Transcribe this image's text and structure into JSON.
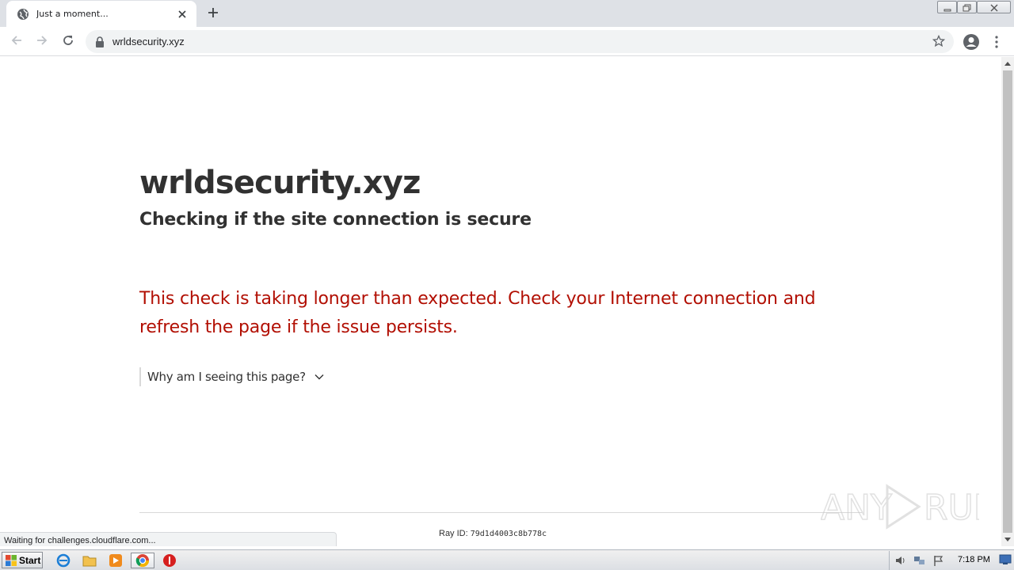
{
  "browser": {
    "tab": {
      "title": "Just a moment...",
      "favicon": "globe-icon",
      "close_icon": "close-icon"
    },
    "new_tab_icon": "plus-icon",
    "window_controls": [
      "minimize-icon",
      "restore-icon",
      "close-icon"
    ],
    "toolbar": {
      "back_icon": "back-arrow-icon",
      "forward_icon": "forward-arrow-icon",
      "reload_icon": "reload-icon",
      "url": "wrldsecurity.xyz",
      "lock_icon": "lock-icon",
      "bookmark_icon": "star-icon",
      "profile_icon": "account-icon",
      "menu_icon": "kebab-menu-icon"
    },
    "status_text": "Waiting for challenges.cloudflare.com..."
  },
  "page": {
    "site_title": "wrldsecurity.xyz",
    "subtitle": "Checking if the site connection is secure",
    "warning": "This check is taking longer than expected. Check your Internet connection and refresh the page if the issue persists.",
    "warning_color": "#b20f03",
    "why_label": "Why am I seeing this page?",
    "ray_label": "Ray ID:",
    "ray_id": "79d1d4003c8b778c",
    "watermark": "ANY RUN"
  },
  "taskbar": {
    "start_label": "Start",
    "apps": [
      "internet-explorer-icon",
      "folder-icon",
      "media-player-icon",
      "chrome-icon",
      "stop-icon"
    ],
    "tray_icons": [
      "speaker-icon",
      "network-icon",
      "flag-icon"
    ],
    "clock": "7:18 PM"
  }
}
